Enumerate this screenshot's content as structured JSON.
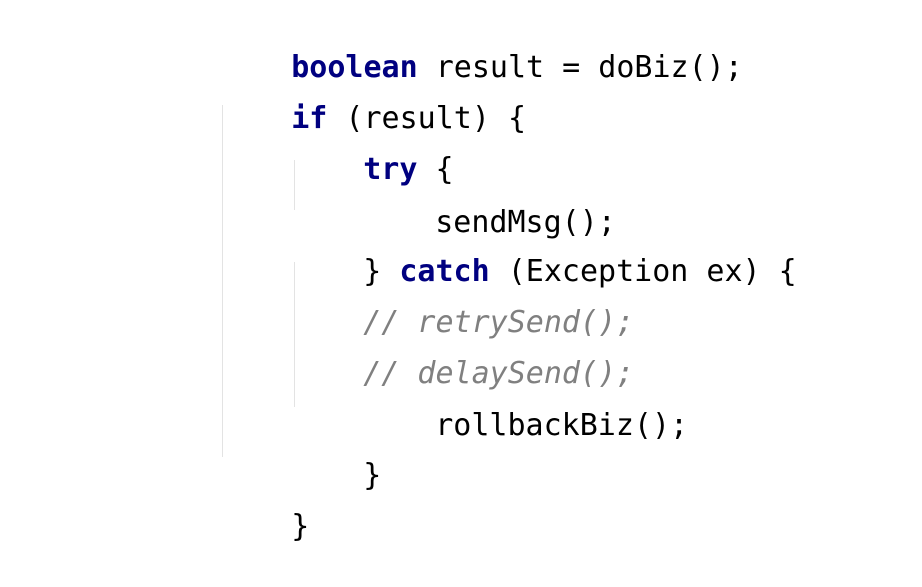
{
  "code": {
    "line1": {
      "kw": "boolean",
      "rest": " result = doBiz();"
    },
    "line2": {
      "kw": "if",
      "rest": " (result) {"
    },
    "line3": {
      "kw": "try",
      "rest": " {"
    },
    "line4": {
      "text": "sendMsg();"
    },
    "line5": {
      "pre": "} ",
      "kw": "catch",
      "rest": " (Exception ex) {"
    },
    "line6": {
      "comment": "// retrySend();"
    },
    "line7": {
      "comment": "// delaySend();"
    },
    "line8": {
      "text": "rollbackBiz();"
    },
    "line9": {
      "text": "}"
    },
    "line10": {
      "text": "}"
    }
  },
  "colors": {
    "keyword": "#000080",
    "comment": "#808080",
    "text": "#000000",
    "indent_guide": "#e3e3e3",
    "background": "#ffffff"
  }
}
